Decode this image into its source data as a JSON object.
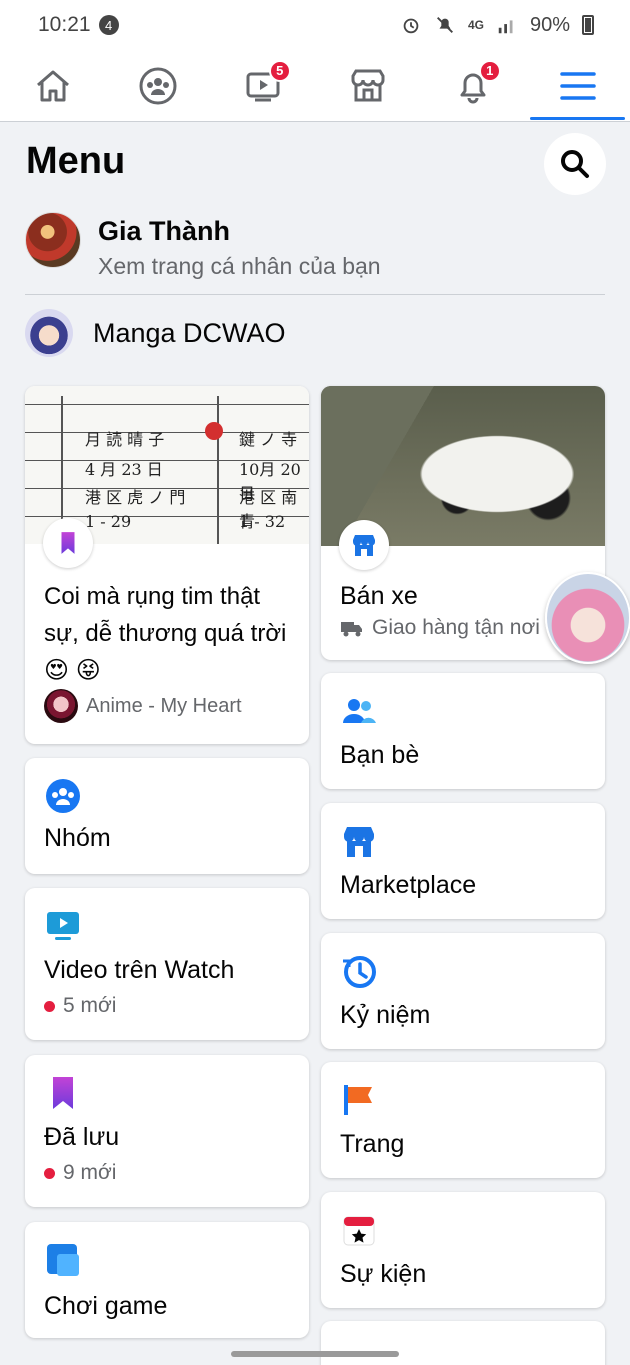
{
  "status_bar": {
    "time": "10:21",
    "notification_count": "4",
    "network": "4G",
    "battery": "90%"
  },
  "nav": {
    "watch_badge": "5",
    "notifications_badge": "1"
  },
  "header": {
    "title": "Menu"
  },
  "profile": {
    "name": "Gia Thành",
    "subtitle": "Xem trang cá nhân của bạn"
  },
  "page": {
    "name": "Manga DCWAO"
  },
  "post_card": {
    "text": "Coi mà rụng tim thật sự, dễ thương quá trời 😍 😝",
    "source": "Anime - My Heart"
  },
  "marketplace_card": {
    "title": "Bán xe",
    "subtitle": "Giao hàng tận nơi"
  },
  "shortcuts_left": [
    {
      "label": "Nhóm",
      "sub": ""
    },
    {
      "label": "Video trên Watch",
      "sub": "5 mới"
    },
    {
      "label": "Đã lưu",
      "sub": "9 mới"
    },
    {
      "label": "Chơi game",
      "sub": ""
    }
  ],
  "shortcuts_right": [
    {
      "label": "Bạn bè"
    },
    {
      "label": "Marketplace"
    },
    {
      "label": "Kỷ niệm"
    },
    {
      "label": "Trang"
    },
    {
      "label": "Sự kiện"
    }
  ],
  "colors": {
    "accent": "#1877f2",
    "badge": "#e41e3f",
    "background": "#f0f2f5"
  }
}
